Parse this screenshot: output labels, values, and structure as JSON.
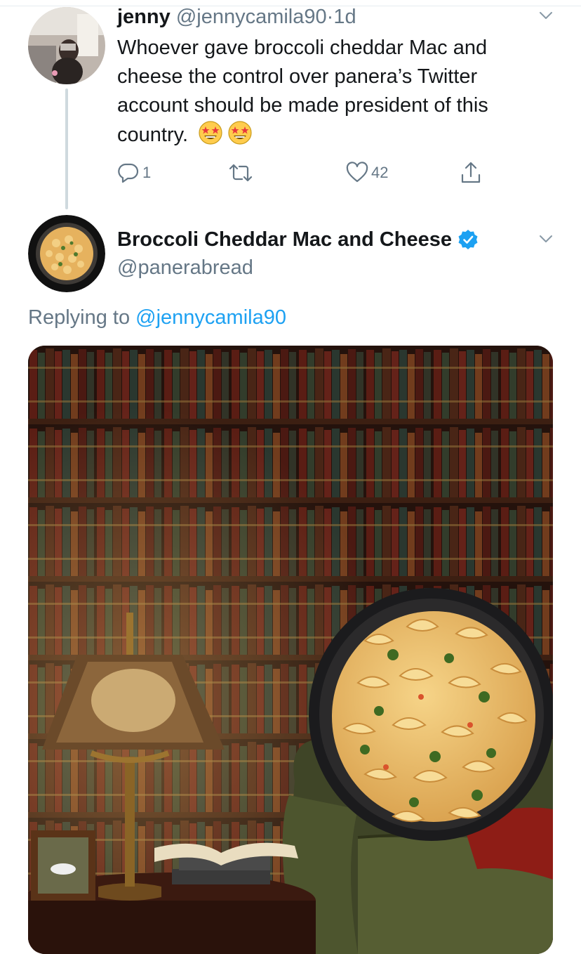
{
  "tweet1": {
    "name": "jenny",
    "handle": "@jennycamila90",
    "separator": "·",
    "age": "1d",
    "text": "Whoever gave broccoli cheddar Mac and cheese the control over panera’s Twitter account should be made president of this country.",
    "emoji": "star-struck-emoji",
    "reply_count": "1",
    "like_count": "42"
  },
  "tweet2": {
    "name": "Broccoli Cheddar Mac and Cheese",
    "handle": "@panerabread",
    "replying_prefix": "Replying to",
    "replying_to": "@jennycamila90"
  },
  "colors": {
    "text": "#14171a",
    "muted": "#657786",
    "link": "#1da1f2",
    "verified": "#1da1f2",
    "thread_line": "#cfd9de"
  }
}
